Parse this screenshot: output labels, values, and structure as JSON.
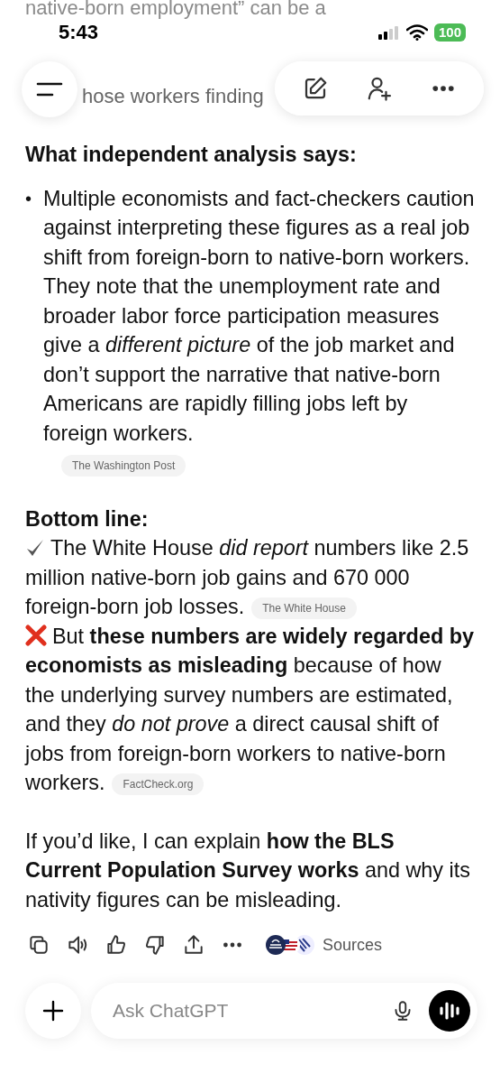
{
  "status_bar": {
    "time": "5:43",
    "battery": "100"
  },
  "faded_lines": [
    {
      "text": "native-born employment” can be a"
    },
    {
      "text": "hose workers finding"
    }
  ],
  "sections": [
    {
      "kind": "heading",
      "text": "What independent analysis says:"
    },
    {
      "kind": "bullet",
      "marker": "•",
      "text": "Multiple economists and fact-checkers caution against interpreting these figures as a real job shift from foreign-born to native-born workers. They note that the unemployment rate and broader labor force participation measures give a *different picture* of the job market and don’t support the narrative that native-born Americans are rapidly filling jobs left by foreign workers.",
      "source": "The Washington Post"
    },
    {
      "kind": "heading",
      "text": "Bottom line:"
    },
    {
      "kind": "check",
      "text": "The White House *did report* numbers like 2.5 million native-born job gains and 670 000 foreign-born job losses.",
      "source": "The White House"
    },
    {
      "kind": "cross",
      "text": "But **these numbers are widely regarded by economists as misleading** because of how the underlying survey numbers are estimated, and they *do not prove* a direct causal shift of jobs from foreign-born workers to native-born workers.",
      "source": "FactCheck.org"
    },
    {
      "kind": "paragraph",
      "text": "If you’d like, I can explain **how the BLS Current Population Survey works** and why its nativity figures can be misleading."
    }
  ],
  "actions": {
    "sources_label": "Sources"
  },
  "composer": {
    "placeholder": "Ask ChatGPT"
  }
}
